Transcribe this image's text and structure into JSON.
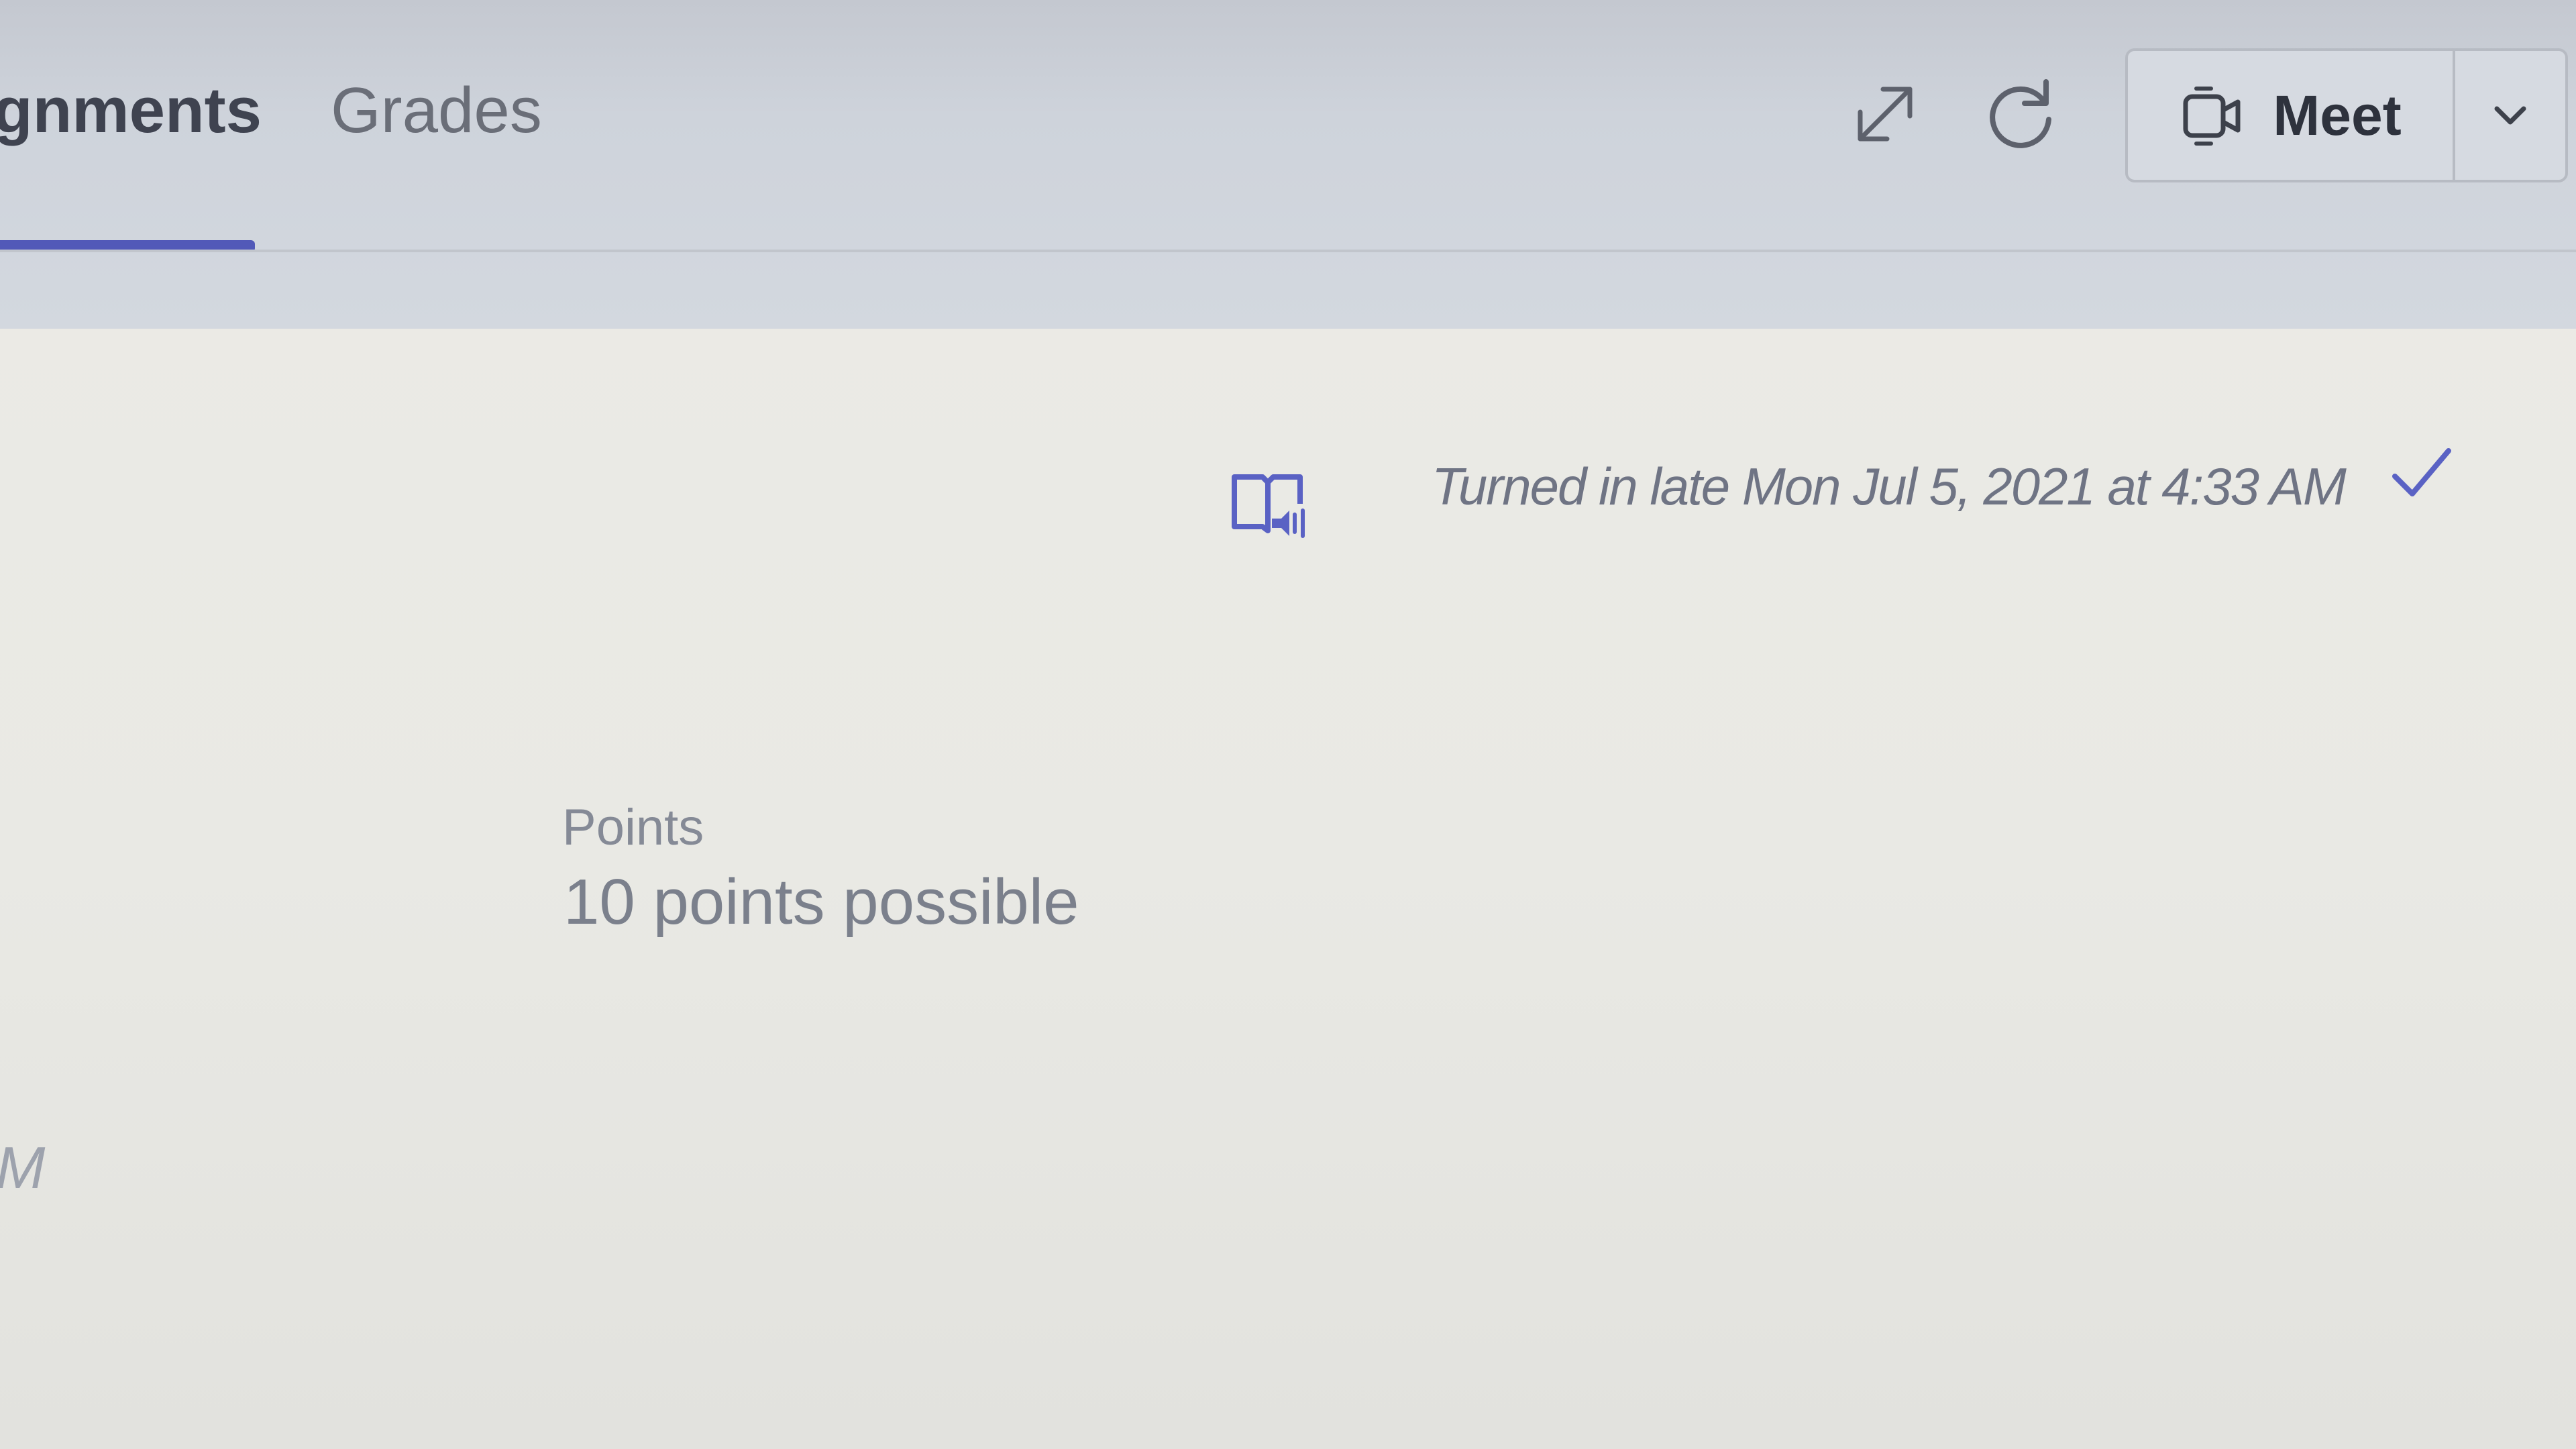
{
  "tabs": [
    {
      "label": "gnments",
      "active": true
    },
    {
      "label": "Grades",
      "active": false
    }
  ],
  "toolbar": {
    "expand_icon": "expand-icon",
    "refresh_icon": "refresh-icon",
    "meet_label": "Meet",
    "meet_icon": "video-camera-icon",
    "meet_dropdown_icon": "chevron-down-icon"
  },
  "submission": {
    "reader_icon": "immersive-reader-icon",
    "status": "Turned in late Mon Jul 5, 2021 at 4:33 AM",
    "status_icon": "checkmark-icon"
  },
  "points": {
    "label": "Points",
    "value": "10 points possible"
  },
  "edge_fragment": "M",
  "colors": {
    "accent": "#5259b8",
    "header_bg": "#cfd4db",
    "content_bg": "#eaeae5",
    "status_text": "#6f7484"
  }
}
